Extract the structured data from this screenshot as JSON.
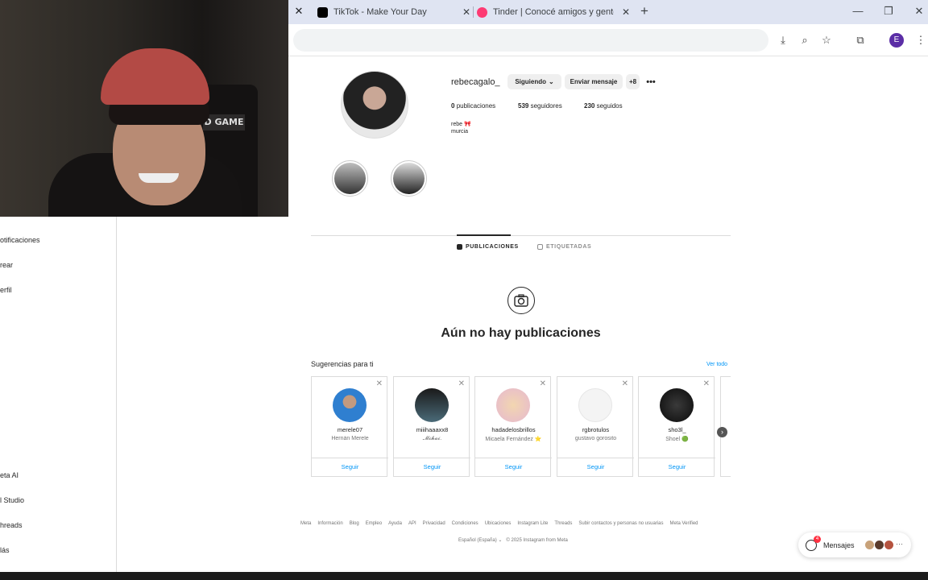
{
  "browser": {
    "tabs": [
      {
        "title": "TikTok - Make Your Day",
        "color": "#000000"
      },
      {
        "title": "Tinder | Conocé amigos y gente",
        "color": "#fd3a73"
      }
    ],
    "profile_initial": "E"
  },
  "sidebar": {
    "items": [
      "otificaciones",
      "rear",
      "erfil",
      "eta AI",
      "l Studio",
      "hreads",
      "lás"
    ]
  },
  "profile": {
    "username": "rebecagalo_",
    "following_button": "Siguiendo",
    "message_button": "Enviar mensaje",
    "posts_count": "0",
    "posts_label": "publicaciones",
    "followers_count": "539",
    "followers_label": "seguidores",
    "following_count": "230",
    "following_label": "seguidos",
    "bio_name": "rebe 🎀",
    "bio_location": "murcia"
  },
  "tabs": {
    "posts": "PUBLICACIONES",
    "tagged": "ETIQUETADAS"
  },
  "empty_state": {
    "title": "Aún no hay publicaciones"
  },
  "suggestions": {
    "title": "Sugerencias para ti",
    "see_all": "Ver todo",
    "follow_label": "Seguir",
    "cards": [
      {
        "username": "merele07",
        "name": "Hernán Merele"
      },
      {
        "username": "miiihaaaxx8",
        "name": "𝓜𝓲𝓱𝓪𝓲."
      },
      {
        "username": "hadadelosbrillos",
        "name": "Micaela Fernández ⭐"
      },
      {
        "username": "rgbrotulos",
        "name": "gustavo gorosito"
      },
      {
        "username": "sho3l_",
        "name": "Shoel 🟢"
      }
    ]
  },
  "footer": {
    "links": [
      "Meta",
      "Información",
      "Blog",
      "Empleo",
      "Ayuda",
      "API",
      "Privacidad",
      "Condiciones",
      "Ubicaciones",
      "Instagram Lite",
      "Threads",
      "Subir contactos y personas no usuarias",
      "Meta Verified"
    ],
    "language": "Español (España)",
    "copyright": "© 2025 Instagram from Meta"
  },
  "messages": {
    "label": "Mensajes",
    "badge": "4"
  },
  "colors": {
    "accent": "#0095f6",
    "border": "#dbdbdb"
  }
}
